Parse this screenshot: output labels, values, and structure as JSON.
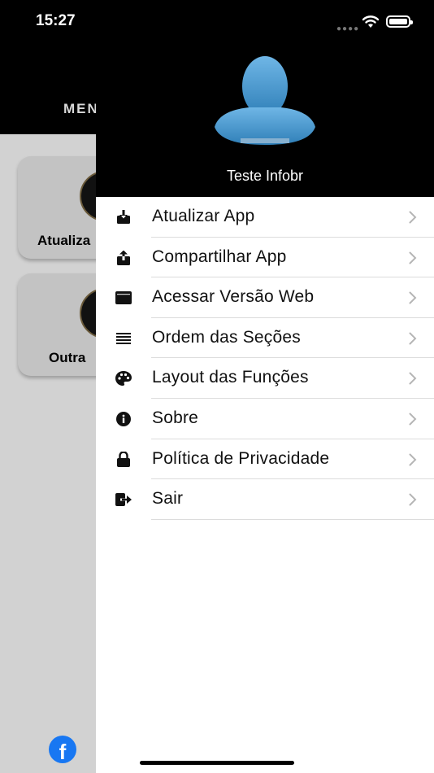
{
  "status_bar": {
    "time": "15:27"
  },
  "background": {
    "header_title": "MEN",
    "cards": [
      {
        "label": "Atualiza"
      },
      {
        "label": "Outra"
      }
    ]
  },
  "drawer": {
    "user_name": "Teste Infobr",
    "menu": [
      {
        "label": "Atualizar App",
        "icon": "download-icon"
      },
      {
        "label": "Compartilhar App",
        "icon": "share-icon"
      },
      {
        "label": "Acessar Versão Web",
        "icon": "browser-window-icon"
      },
      {
        "label": "Ordem das Seções",
        "icon": "list-icon"
      },
      {
        "label": "Layout das Funções",
        "icon": "palette-icon"
      },
      {
        "label": "Sobre",
        "icon": "info-icon"
      },
      {
        "label": "Política de Privacidade",
        "icon": "lock-icon"
      },
      {
        "label": "Sair",
        "icon": "sign-out-icon"
      }
    ]
  }
}
